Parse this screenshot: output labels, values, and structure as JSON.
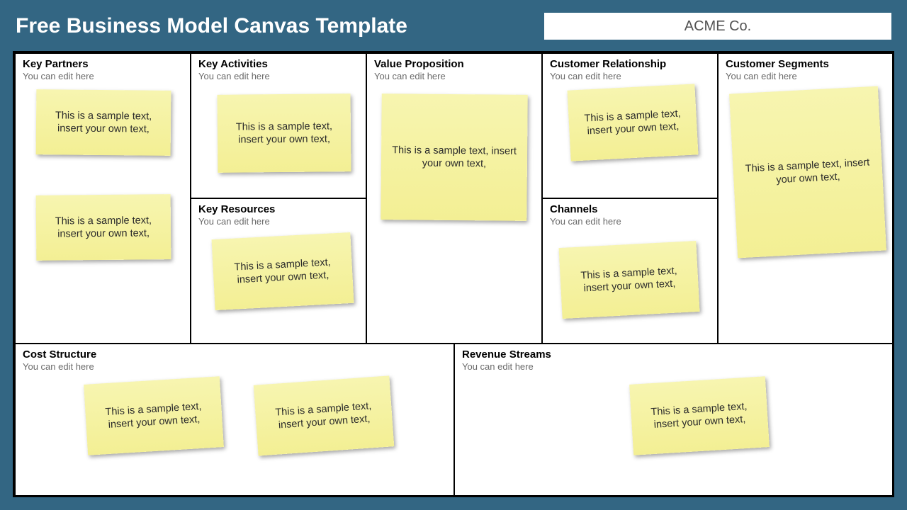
{
  "header": {
    "title": "Free Business Model Canvas Template",
    "company": "ACME Co."
  },
  "subtitle_text": "You can edit here",
  "sticky_text": "This is a sample text, insert your own text,",
  "cells": {
    "key_partners": "Key Partners",
    "key_activities": "Key Activities",
    "key_resources": "Key Resources",
    "value_proposition": "Value Proposition",
    "customer_relationship": "Customer Relationship",
    "channels": "Channels",
    "customer_segments": "Customer Segments",
    "cost_structure": "Cost Structure",
    "revenue_streams": "Revenue Streams"
  }
}
